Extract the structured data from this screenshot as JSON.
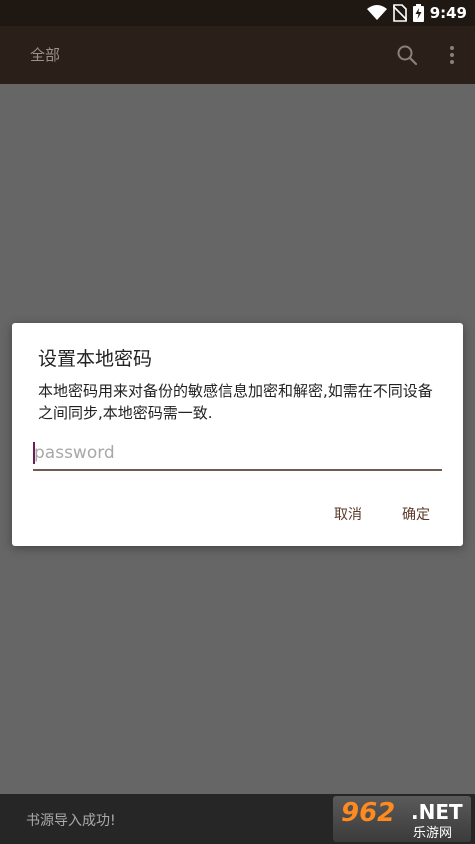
{
  "status_bar": {
    "time": "9:49",
    "icons": [
      "wifi-icon",
      "no-sim-icon",
      "battery-charging-icon"
    ]
  },
  "app_bar": {
    "title": "全部",
    "icons": [
      "search-icon",
      "more-vert-icon"
    ]
  },
  "dialog": {
    "title": "设置本地密码",
    "message": "本地密码用来对备份的敏感信息加密和解密,如需在不同设备之间同步,本地密码需一致.",
    "password_placeholder": "password",
    "password_value": "",
    "cancel_label": "取消",
    "ok_label": "确定"
  },
  "snackbar": {
    "text": "书源导入成功!"
  },
  "watermark": {
    "number": "962",
    "suffix": ".NET",
    "subtitle": "乐游网"
  },
  "colors": {
    "status_bar": "#1e1712",
    "app_bar": "#2a2019",
    "scrim": "#666666",
    "accent": "#6d1f55",
    "button_text": "#5b3a2a"
  }
}
